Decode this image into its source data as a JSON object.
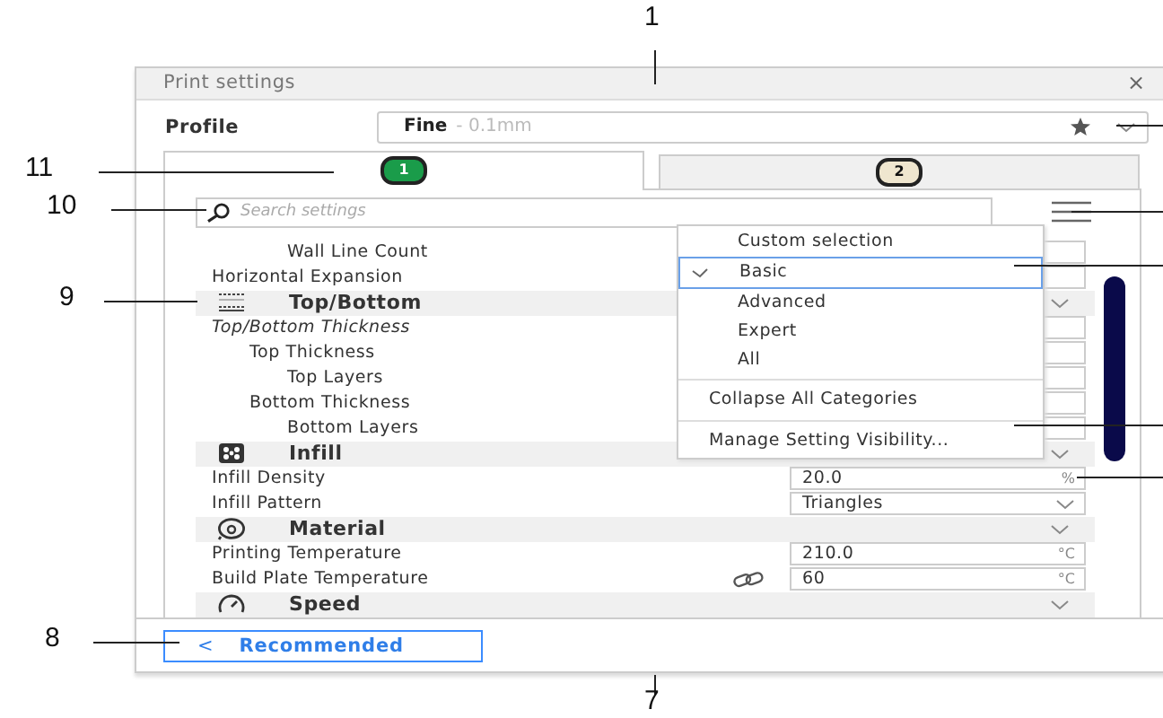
{
  "window": {
    "title": "Print settings",
    "close": "×"
  },
  "profile": {
    "label": "Profile",
    "name": "Fine",
    "detail": "- 0.1mm"
  },
  "tabs": [
    {
      "label": "1",
      "selected": true
    },
    {
      "label": "2",
      "selected": false
    }
  ],
  "search": {
    "placeholder": "Search settings"
  },
  "settings": [
    {
      "kind": "group",
      "children": [
        {
          "kind": "group",
          "children": [
            {
              "kind": "setting",
              "label": "Wall Line Count",
              "italic": false,
              "dropdown": false
            }
          ]
        }
      ]
    },
    {
      "kind": "setting",
      "label": "Horizontal Expansion",
      "italic": false,
      "dropdown": false
    },
    {
      "kind": "category",
      "label": "Top/Bottom"
    },
    {
      "kind": "setting",
      "label": "Top/Bottom Thickness",
      "italic": true,
      "dropdown": false,
      "children": [
        {
          "kind": "setting",
          "label": "Top Thickness",
          "italic": false,
          "dropdown": false,
          "children": [
            {
              "kind": "setting",
              "label": "Top Layers",
              "italic": false,
              "dropdown": false
            }
          ]
        },
        {
          "kind": "setting",
          "label": "Bottom Thickness",
          "italic": false,
          "dropdown": false,
          "children": [
            {
              "kind": "setting",
              "label": "Bottom Layers",
              "italic": false,
              "dropdown": false
            }
          ]
        }
      ]
    },
    {
      "kind": "category",
      "label": "Infill"
    },
    {
      "kind": "setting",
      "label": "Infill Density",
      "italic": false,
      "dropdown": false,
      "value": "20.0",
      "unit": "%"
    },
    {
      "kind": "setting",
      "label": "Infill Pattern",
      "italic": false,
      "dropdown": true,
      "value": "Triangles"
    },
    {
      "kind": "category",
      "label": "Material"
    },
    {
      "kind": "setting",
      "label": "Printing Temperature",
      "italic": false,
      "dropdown": false,
      "value": "210.0",
      "unit": "°C"
    },
    {
      "kind": "setting",
      "label": "Build Plate Temperature",
      "italic": false,
      "linked": true,
      "dropdown": false,
      "value": "60",
      "unit": "°C"
    },
    {
      "kind": "category",
      "label": "Speed"
    }
  ],
  "menu": {
    "sections": [
      {
        "kind": "levels",
        "items": [
          {
            "label": "Custom selection",
            "selected": false
          },
          {
            "label": "Basic",
            "selected": true
          },
          {
            "label": "Advanced",
            "selected": false
          },
          {
            "label": "Expert",
            "selected": false
          },
          {
            "label": "All",
            "selected": false
          }
        ]
      },
      {
        "kind": "actions",
        "items": [
          {
            "label": "Collapse All Categories"
          }
        ]
      },
      {
        "kind": "actions",
        "items": [
          {
            "label": "Manage Setting Visibility..."
          }
        ]
      }
    ]
  },
  "footer": {
    "back": "<",
    "button": "Recommended"
  },
  "callouts": [
    {
      "label": "1"
    },
    {
      "label": "11"
    },
    {
      "label": "10"
    },
    {
      "label": "9"
    },
    {
      "label": "8"
    },
    {
      "label": "7"
    }
  ]
}
